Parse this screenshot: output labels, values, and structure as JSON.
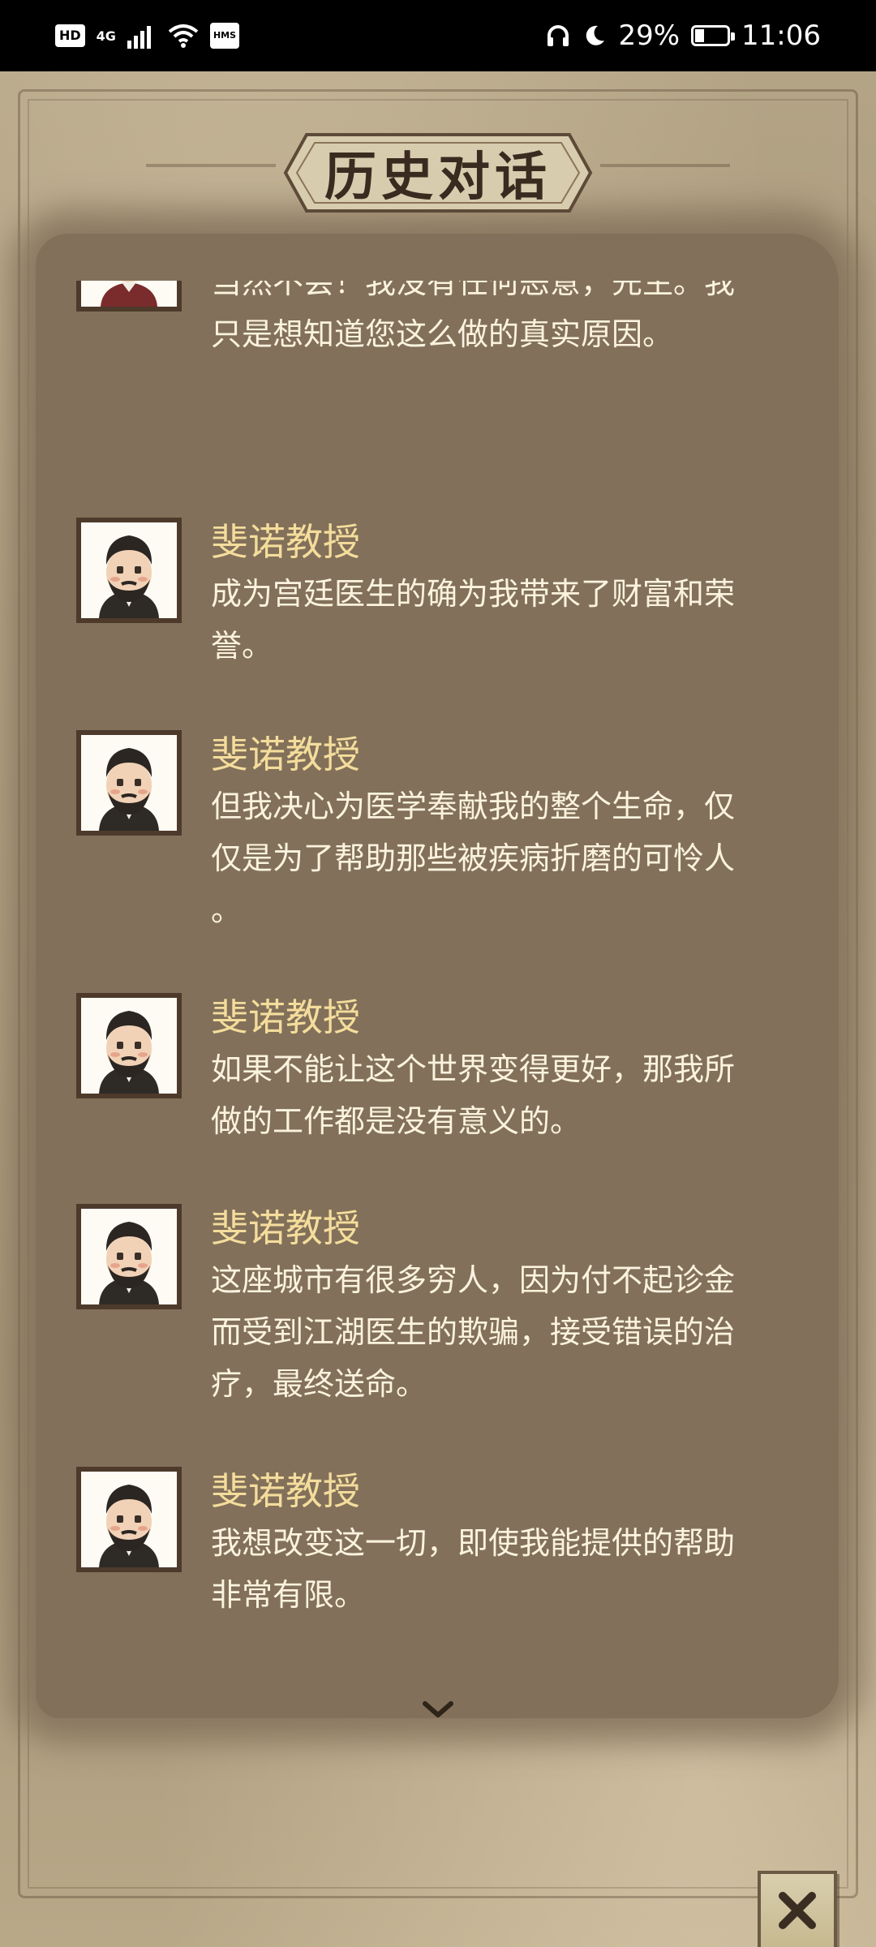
{
  "status_bar": {
    "hd_badge": "HD",
    "network_label": "4G",
    "hms_badge": "HMS",
    "battery_text": "29%",
    "battery_level": 0.29,
    "time": "11:06",
    "icons": [
      "headphones-icon",
      "moon-icon",
      "battery-icon",
      "wifi-icon",
      "signal-icon"
    ]
  },
  "title": "历史对话",
  "entries": [
    {
      "speaker": "",
      "avatar": "blond-boy-avatar",
      "lines": [
        "当然不会！我没有任何恶意，先生。我",
        "只是想知道您这么做的真实原因。"
      ]
    },
    {
      "speaker": "斐诺教授",
      "avatar": "professor-avatar",
      "lines": [
        "成为宫廷医生的确为我带来了财富和荣",
        "誉。"
      ]
    },
    {
      "speaker": "斐诺教授",
      "avatar": "professor-avatar",
      "lines": [
        "但我决心为医学奉献我的整个生命，仅",
        "仅是为了帮助那些被疾病折磨的可怜人",
        "。"
      ]
    },
    {
      "speaker": "斐诺教授",
      "avatar": "professor-avatar",
      "lines": [
        "如果不能让这个世界变得更好，那我所",
        "做的工作都是没有意义的。"
      ]
    },
    {
      "speaker": "斐诺教授",
      "avatar": "professor-avatar",
      "lines": [
        "这座城市有很多穷人，因为付不起诊金",
        "而受到江湖医生的欺骗，接受错误的治",
        "疗，最终送命。"
      ]
    },
    {
      "speaker": "斐诺教授",
      "avatar": "professor-avatar",
      "lines": [
        "我想改变这一切，即使我能提供的帮助",
        "非常有限。"
      ]
    }
  ],
  "colors": {
    "speaker": "#f4dd9c",
    "text": "#fbf3de",
    "panel": "#82705a",
    "title": "#3a2b20"
  }
}
